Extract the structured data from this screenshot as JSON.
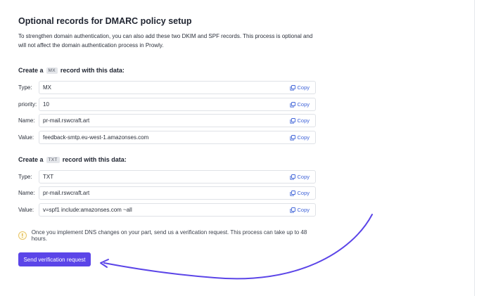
{
  "title": "Optional records for DMARC policy setup",
  "description": "To strengthen domain authentication, you can also add these two DKIM and SPF records. This process is optional and will not affect the domain authentication process in Prowly.",
  "mx_section": {
    "prefix": "Create a",
    "tag": "MX",
    "suffix": "record with this data:",
    "rows": [
      {
        "label": "Type:",
        "value": "MX"
      },
      {
        "label": "priority:",
        "value": "10"
      },
      {
        "label": "Name:",
        "value": "pr-mail.rswcraft.art"
      },
      {
        "label": "Value:",
        "value": "feedback-smtp.eu-west-1.amazonses.com"
      }
    ]
  },
  "txt_section": {
    "prefix": "Create a",
    "tag": "TXT",
    "suffix": "record with this data:",
    "rows": [
      {
        "label": "Type:",
        "value": "TXT"
      },
      {
        "label": "Name:",
        "value": "pr-mail.rswcraft.art"
      },
      {
        "label": "Value:",
        "value": "v=spf1 include:amazonses.com ~all"
      }
    ]
  },
  "copy_label": "Copy",
  "notice": {
    "icon": "warning-icon",
    "icon_glyph": "!",
    "text": "Once you implement DNS changes on your part, send us a verification request. This process can take up to 48 hours."
  },
  "verify_button": "Send verification request",
  "colors": {
    "accent": "#5b45e8",
    "link": "#3f63d8",
    "arrow": "#5b45e8"
  }
}
